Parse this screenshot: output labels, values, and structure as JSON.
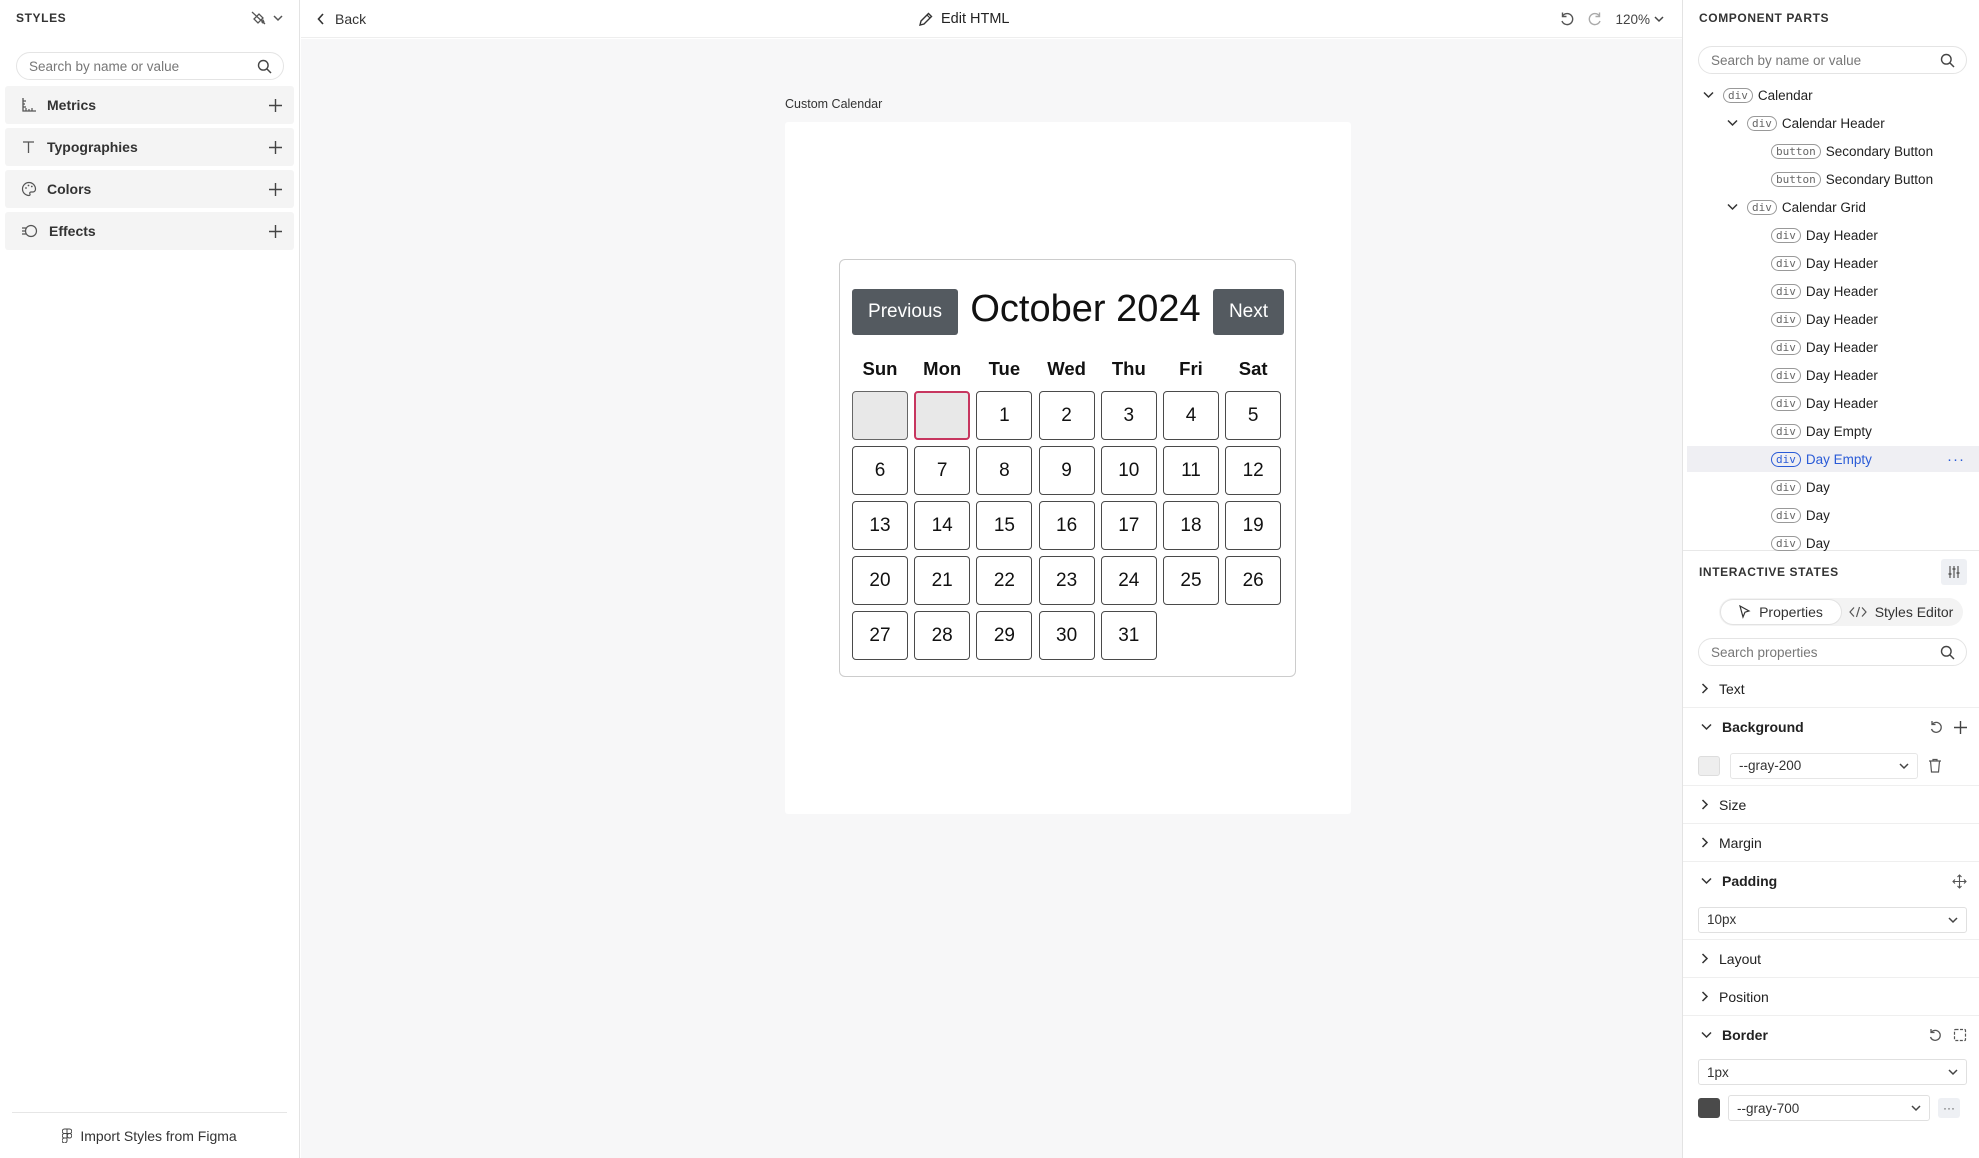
{
  "left_panel": {
    "title": "STYLES",
    "search_placeholder": "Search by name or value",
    "items": [
      {
        "label": "Metrics",
        "icon": "ruler-icon"
      },
      {
        "label": "Typographies",
        "icon": "text-icon"
      },
      {
        "label": "Colors",
        "icon": "palette-icon"
      },
      {
        "label": "Effects",
        "icon": "effects-icon"
      }
    ],
    "import_label": "Import Styles from Figma"
  },
  "topbar": {
    "back_label": "Back",
    "edit_label": "Edit HTML",
    "zoom": "120%"
  },
  "canvas": {
    "frame_label": "Custom Calendar",
    "calendar": {
      "prev_label": "Previous",
      "next_label": "Next",
      "month_title": "October 2024",
      "weekdays": [
        "Sun",
        "Mon",
        "Tue",
        "Wed",
        "Thu",
        "Fri",
        "Sat"
      ],
      "leading_empty_days": 2,
      "selected_empty_index": 1,
      "days": [
        "1",
        "2",
        "3",
        "4",
        "5",
        "6",
        "7",
        "8",
        "9",
        "10",
        "11",
        "12",
        "13",
        "14",
        "15",
        "16",
        "17",
        "18",
        "19",
        "20",
        "21",
        "22",
        "23",
        "24",
        "25",
        "26",
        "27",
        "28",
        "29",
        "30",
        "31"
      ]
    }
  },
  "right_panel": {
    "title": "COMPONENT PARTS",
    "search_placeholder": "Search by name or value",
    "tree": [
      {
        "tag": "div",
        "label": "Calendar",
        "depth": 0,
        "caret": true
      },
      {
        "tag": "div",
        "label": "Calendar Header",
        "depth": 1,
        "caret": true
      },
      {
        "tag": "button",
        "label": "Secondary Button",
        "depth": 2,
        "caret": false
      },
      {
        "tag": "button",
        "label": "Secondary Button",
        "depth": 2,
        "caret": false
      },
      {
        "tag": "div",
        "label": "Calendar Grid",
        "depth": 1,
        "caret": true
      },
      {
        "tag": "div",
        "label": "Day Header",
        "depth": 2,
        "caret": false
      },
      {
        "tag": "div",
        "label": "Day Header",
        "depth": 2,
        "caret": false
      },
      {
        "tag": "div",
        "label": "Day Header",
        "depth": 2,
        "caret": false
      },
      {
        "tag": "div",
        "label": "Day Header",
        "depth": 2,
        "caret": false
      },
      {
        "tag": "div",
        "label": "Day Header",
        "depth": 2,
        "caret": false
      },
      {
        "tag": "div",
        "label": "Day Header",
        "depth": 2,
        "caret": false
      },
      {
        "tag": "div",
        "label": "Day Header",
        "depth": 2,
        "caret": false
      },
      {
        "tag": "div",
        "label": "Day Empty",
        "depth": 2,
        "caret": false
      },
      {
        "tag": "div",
        "label": "Day Empty",
        "depth": 2,
        "caret": false,
        "selected": true
      },
      {
        "tag": "div",
        "label": "Day",
        "depth": 2,
        "caret": false
      },
      {
        "tag": "div",
        "label": "Day",
        "depth": 2,
        "caret": false
      },
      {
        "tag": "div",
        "label": "Day",
        "depth": 2,
        "caret": false
      }
    ],
    "states_title": "INTERACTIVE STATES",
    "tabs": {
      "properties": "Properties",
      "styles_editor": "Styles Editor"
    },
    "props_search_placeholder": "Search properties",
    "sections": {
      "text": "Text",
      "background": "Background",
      "background_value": "--gray-200",
      "background_color": "#eeeeee",
      "size": "Size",
      "margin": "Margin",
      "padding": "Padding",
      "padding_value": "10px",
      "layout": "Layout",
      "position": "Position",
      "border": "Border",
      "border_width": "1px",
      "border_color_value": "--gray-700",
      "border_color": "#4a4a4a"
    }
  },
  "colors": {
    "accent": "#2a5bd7",
    "selected_outline": "#c7365f",
    "button_bg": "#545a60"
  }
}
